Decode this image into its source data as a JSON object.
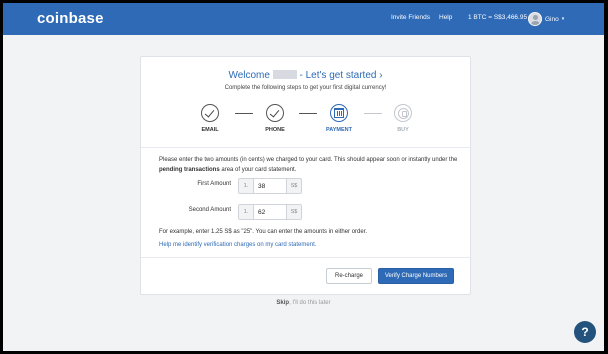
{
  "header": {
    "logo": "coinbase",
    "nav_invite": "Invite Friends",
    "nav_help": "Help",
    "btc_price": "1 BTC = S$3,466.95",
    "user_name": "Gino",
    "caret": "▾"
  },
  "welcome": {
    "prefix": "Welcome",
    "suffix": " - Let's get started ›",
    "subtitle": "Complete the following steps to get your first digital currency!"
  },
  "steps": [
    {
      "label": "EMAIL",
      "state": "done"
    },
    {
      "label": "PHONE",
      "state": "done"
    },
    {
      "label": "PAYMENT",
      "state": "active"
    },
    {
      "label": "BUY",
      "state": "pending"
    }
  ],
  "instructions": {
    "line1": "Please enter the two amounts (in cents) we charged to your card. This should appear soon or instantly under the ",
    "bold": "pending transactions",
    "line2": " area of your card statement."
  },
  "fields": {
    "first_label": "First Amount",
    "first_prefix": "1.",
    "first_value": "38",
    "first_suffix": "S$",
    "second_label": "Second Amount",
    "second_prefix": "1.",
    "second_value": "62",
    "second_suffix": "S$"
  },
  "example_text": "For example, enter 1.25 S$ as \"25\". You can enter the amounts in either order.",
  "help_link": "Help me identify verification charges on my card statement.",
  "buttons": {
    "recharge": "Re-charge",
    "verify": "Verify Charge Numbers"
  },
  "skip": {
    "bold": "Skip",
    "rest": ", I'll do this later"
  },
  "help_fab": "?"
}
